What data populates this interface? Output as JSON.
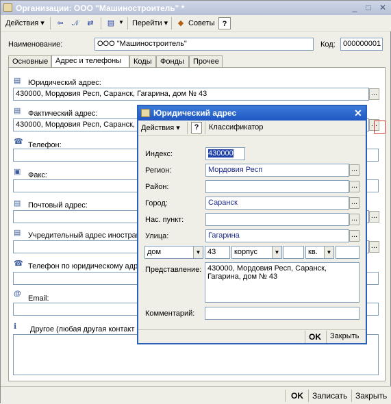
{
  "window": {
    "title": "Организации: ООО \"Машиностроитель\" *"
  },
  "toolbar": {
    "actions_label": "Действия",
    "goto_label": "Перейти",
    "tips_label": "Советы",
    "help_label": "?"
  },
  "header": {
    "name_label": "Наименование:",
    "name_value": "ООО \"Машиностроитель\"",
    "code_label": "Код:",
    "code_value": "000000001"
  },
  "tabs": [
    "Основные",
    "Адрес и телефоны",
    "Коды",
    "Фонды",
    "Прочее"
  ],
  "contacts": {
    "legal_address_label": "Юридический адрес:",
    "legal_address_value": "430000, Мордовия Респ, Саранск, Гагарина, дом № 43",
    "actual_address_label": "Фактический адрес:",
    "actual_address_value": "430000, Мордовия Респ, Саранск, Г",
    "phone_label": "Телефон:",
    "fax_label": "Факс:",
    "postal_label": "Почтовый адрес:",
    "foreign_label": "Учредительный адрес иностран",
    "legal_phone_label": "Телефон по юридическому адре",
    "email_label": "Email:",
    "other_label": "Другое (любая другая контакт"
  },
  "bottom": {
    "ok": "OK",
    "save": "Записать",
    "close": "Закрыть"
  },
  "dialog": {
    "title": "Юридический адрес",
    "actions_label": "Действия",
    "help_label": "?",
    "classifier_label": "Классификатор",
    "index_label": "Индекс:",
    "index_value": "430000",
    "region_label": "Регион:",
    "region_value": "Мордовия Респ",
    "district_label": "Район:",
    "district_value": "",
    "city_label": "Город:",
    "city_value": "Саранск",
    "locality_label": "Нас. пункт:",
    "locality_value": "",
    "street_label": "Улица:",
    "street_value": "Гагарина",
    "house_type": "дом",
    "house_value": "43",
    "building_type": "корпус",
    "building_value": "",
    "apt_type": "кв.",
    "apt_value": "",
    "presentation_label": "Представление:",
    "presentation_line1": "430000, Мордовия Респ, Саранск,",
    "presentation_line2": "Гагарина, дом № 43",
    "comment_label": "Комментарий:",
    "comment_value": "",
    "ok": "OK",
    "close": "Закрыть"
  }
}
